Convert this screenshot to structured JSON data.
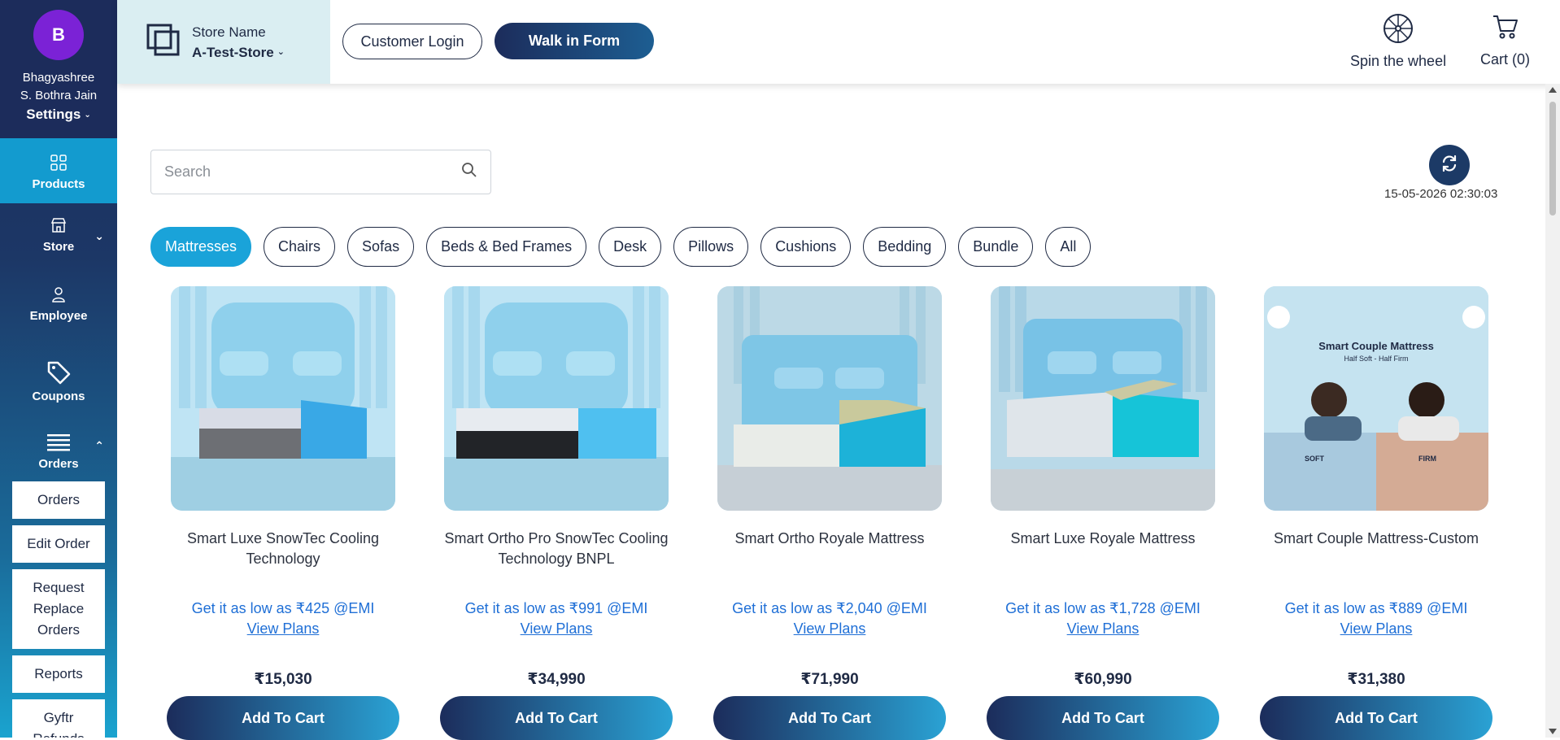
{
  "user": {
    "initial": "B",
    "name_line1": "Bhagyashree",
    "name_line2": "S. Bothra Jain",
    "settings_label": "Settings"
  },
  "sidebar": {
    "items": [
      {
        "label": "Products",
        "icon": "grid-icon",
        "active": true
      },
      {
        "label": "Store",
        "icon": "store-icon"
      },
      {
        "label": "Employee",
        "icon": "person-icon"
      },
      {
        "label": "Coupons",
        "icon": "tag-icon"
      },
      {
        "label": "Orders",
        "icon": "menu-icon"
      }
    ],
    "order_submenu": [
      "Orders",
      "Edit Order",
      "Request Replace Orders",
      "Reports",
      "Gyftr Refunds"
    ]
  },
  "header": {
    "store_label": "Store Name",
    "store_value": "A-Test-Store",
    "customer_login": "Customer Login",
    "walk_in": "Walk in Form",
    "spin": "Spin the wheel",
    "cart": "Cart (0)"
  },
  "search": {
    "placeholder": "Search"
  },
  "timestamp": "15-05-2026 02:30:03",
  "categories": [
    "Mattresses",
    "Chairs",
    "Sofas",
    "Beds & Bed Frames",
    "Desk",
    "Pillows",
    "Cushions",
    "Bedding",
    "Bundle",
    "All"
  ],
  "products": [
    {
      "title": "Smart Luxe SnowTec Cooling Technology",
      "emi": "Get it as low as ₹425 @EMI",
      "plans": "View Plans",
      "price": "₹15,030",
      "cta": "Add To Cart"
    },
    {
      "title": "Smart Ortho Pro SnowTec Cooling Technology BNPL",
      "emi": "Get it as low as ₹991 @EMI",
      "plans": "View Plans",
      "price": "₹34,990",
      "cta": "Add To Cart"
    },
    {
      "title": "Smart Ortho Royale Mattress",
      "emi": "Get it as low as ₹2,040 @EMI",
      "plans": "View Plans",
      "price": "₹71,990",
      "cta": "Add To Cart"
    },
    {
      "title": "Smart Luxe Royale Mattress",
      "emi": "Get it as low as ₹1,728 @EMI",
      "plans": "View Plans",
      "price": "₹60,990",
      "cta": "Add To Cart"
    },
    {
      "title": "Smart Couple Mattress-Custom",
      "emi": "Get it as low as ₹889 @EMI",
      "plans": "View Plans",
      "price": "₹31,380",
      "cta": "Add To Cart"
    }
  ],
  "product_image_text": {
    "heading": "Smart Couple Mattress",
    "sub": "Half Soft - Half Firm",
    "soft": "SOFT",
    "firm": "FIRM"
  }
}
